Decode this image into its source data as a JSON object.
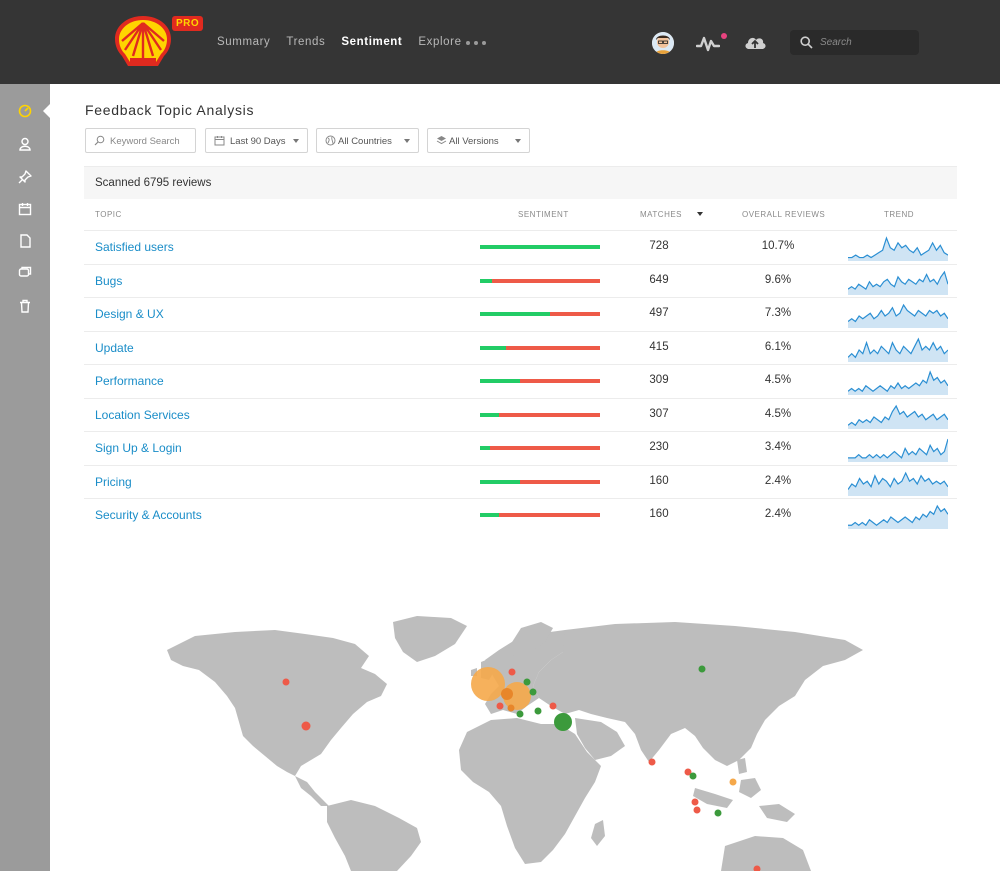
{
  "header": {
    "pro_badge": "PRO",
    "nav": [
      {
        "label": "Summary",
        "active": false
      },
      {
        "label": "Trends",
        "active": false
      },
      {
        "label": "Sentiment",
        "active": true
      },
      {
        "label": "Explore",
        "active": false
      }
    ],
    "search_placeholder": "Search"
  },
  "sidebar": {
    "items": [
      "dashboard-icon",
      "user-icon",
      "pin-icon",
      "calendar-icon",
      "document-icon",
      "chat-icon",
      "trash-icon"
    ]
  },
  "page": {
    "title": "Feedback Topic Analysis"
  },
  "filters": {
    "keyword_placeholder": "Keyword Search",
    "date_range": "Last 90 Days",
    "countries": "All Countries",
    "versions": "All Versions"
  },
  "table": {
    "scanned_label": "Scanned 6795 reviews",
    "headers": {
      "topic": "TOPIC",
      "sentiment": "SENTIMENT",
      "matches": "MATCHES",
      "overall": "OVERALL REVIEWS",
      "trend": "TREND"
    },
    "rows": [
      {
        "topic": "Satisfied users",
        "positive": 1.0,
        "matches": "728",
        "overall": "10.7%",
        "trend": [
          1,
          1,
          2,
          1,
          1,
          2,
          1,
          2,
          3,
          4,
          9,
          5,
          4,
          7,
          5,
          6,
          4,
          3,
          5,
          2,
          3,
          4,
          7,
          4,
          6,
          3,
          2
        ]
      },
      {
        "topic": "Bugs",
        "positive": 0.1,
        "matches": "649",
        "overall": "9.6%",
        "trend": [
          2,
          3,
          2,
          4,
          3,
          2,
          5,
          3,
          4,
          3,
          5,
          6,
          4,
          3,
          7,
          5,
          4,
          6,
          5,
          4,
          6,
          5,
          8,
          5,
          6,
          4,
          7,
          9,
          4
        ]
      },
      {
        "topic": "Design & UX",
        "positive": 0.58,
        "matches": "497",
        "overall": "7.3%",
        "trend": [
          2,
          3,
          2,
          4,
          3,
          4,
          5,
          3,
          4,
          6,
          4,
          5,
          7,
          4,
          5,
          8,
          6,
          5,
          4,
          6,
          5,
          4,
          6,
          5,
          6,
          4,
          5,
          3
        ]
      },
      {
        "topic": "Update",
        "positive": 0.22,
        "matches": "415",
        "overall": "6.1%",
        "trend": [
          1,
          2,
          1,
          3,
          2,
          5,
          2,
          3,
          2,
          4,
          3,
          2,
          5,
          3,
          2,
          4,
          3,
          2,
          4,
          6,
          3,
          4,
          3,
          5,
          3,
          4,
          2,
          3
        ]
      },
      {
        "topic": "Performance",
        "positive": 0.33,
        "matches": "309",
        "overall": "4.5%",
        "trend": [
          1,
          2,
          1,
          2,
          1,
          3,
          2,
          1,
          2,
          3,
          2,
          1,
          3,
          2,
          4,
          2,
          3,
          2,
          3,
          4,
          3,
          5,
          4,
          8,
          5,
          6,
          4,
          5,
          3
        ]
      },
      {
        "topic": "Location Services",
        "positive": 0.16,
        "matches": "307",
        "overall": "4.5%",
        "trend": [
          1,
          2,
          1,
          3,
          2,
          3,
          2,
          4,
          3,
          2,
          4,
          3,
          6,
          8,
          5,
          6,
          4,
          5,
          6,
          4,
          5,
          3,
          4,
          5,
          3,
          4,
          5,
          3
        ]
      },
      {
        "topic": "Sign Up & Login",
        "positive": 0.08,
        "matches": "230",
        "overall": "3.4%",
        "trend": [
          1,
          1,
          1,
          2,
          1,
          1,
          2,
          1,
          2,
          1,
          2,
          1,
          2,
          3,
          2,
          1,
          4,
          2,
          3,
          2,
          4,
          3,
          2,
          5,
          3,
          4,
          2,
          3,
          7
        ]
      },
      {
        "topic": "Pricing",
        "positive": 0.33,
        "matches": "160",
        "overall": "2.4%",
        "trend": [
          2,
          4,
          3,
          6,
          4,
          5,
          3,
          7,
          4,
          6,
          5,
          3,
          6,
          4,
          5,
          8,
          5,
          6,
          4,
          7,
          5,
          6,
          4,
          5,
          4,
          5,
          3
        ]
      },
      {
        "topic": "Security & Accounts",
        "positive": 0.16,
        "matches": "160",
        "overall": "2.4%",
        "trend": [
          1,
          1,
          2,
          1,
          2,
          1,
          3,
          2,
          1,
          2,
          3,
          2,
          4,
          3,
          2,
          3,
          4,
          3,
          2,
          4,
          3,
          5,
          4,
          6,
          5,
          8,
          6,
          7,
          5
        ]
      }
    ]
  },
  "colors": {
    "link": "#1a8dc8",
    "positive": "#22cc66",
    "negative": "#ee5a48",
    "trend": "#2b8fd3",
    "trend_fill": "#cfe4f4",
    "map_land": "#bdbdbd"
  }
}
